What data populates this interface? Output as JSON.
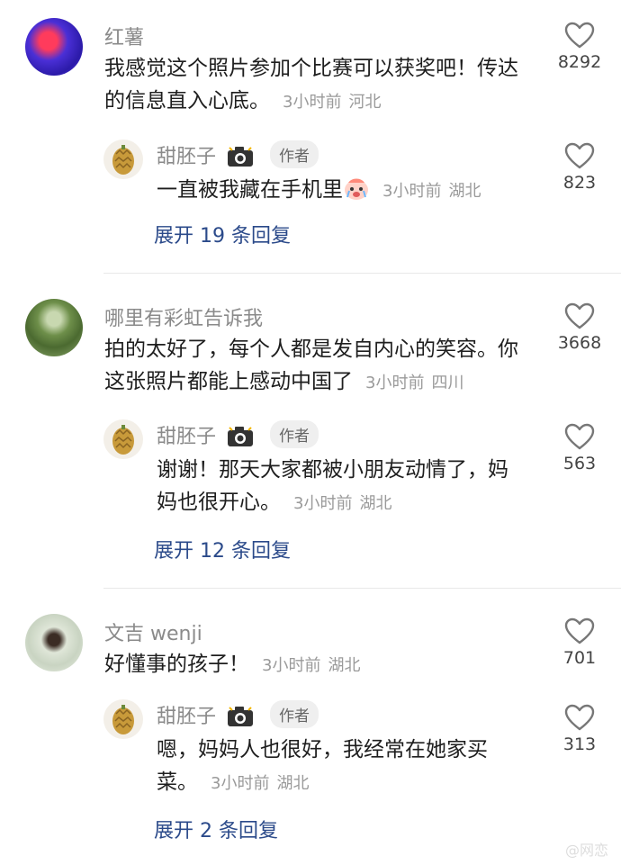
{
  "comments": [
    {
      "user": "红薯",
      "text": "我感觉这个照片参加个比赛可以获奖吧！传达的信息直入心底。",
      "time": "3小时前",
      "location": "河北",
      "likes": "8292",
      "reply": {
        "user": "甜胚子",
        "badge": "作者",
        "text": "一直被我藏在手机里",
        "time": "3小时前",
        "location": "湖北",
        "likes": "823"
      },
      "expand": "展开 19 条回复"
    },
    {
      "user": "哪里有彩虹告诉我",
      "text": "拍的太好了，每个人都是发自内心的笑容。你这张照片都能上感动中国了",
      "time": "3小时前",
      "location": "四川",
      "likes": "3668",
      "reply": {
        "user": "甜胚子",
        "badge": "作者",
        "text": "谢谢！那天大家都被小朋友动情了，妈妈也很开心。",
        "time": "3小时前",
        "location": "湖北",
        "likes": "563"
      },
      "expand": "展开 12 条回复"
    },
    {
      "user": "文吉 wenji",
      "text": "好懂事的孩子！",
      "time": "3小时前",
      "location": "湖北",
      "likes": "701",
      "reply": {
        "user": "甜胚子",
        "badge": "作者",
        "text": "嗯，妈妈人也很好，我经常在她家买菜。",
        "time": "3小时前",
        "location": "湖北",
        "likes": "313"
      },
      "expand": "展开 2 条回复"
    }
  ],
  "watermark": "@网恋"
}
